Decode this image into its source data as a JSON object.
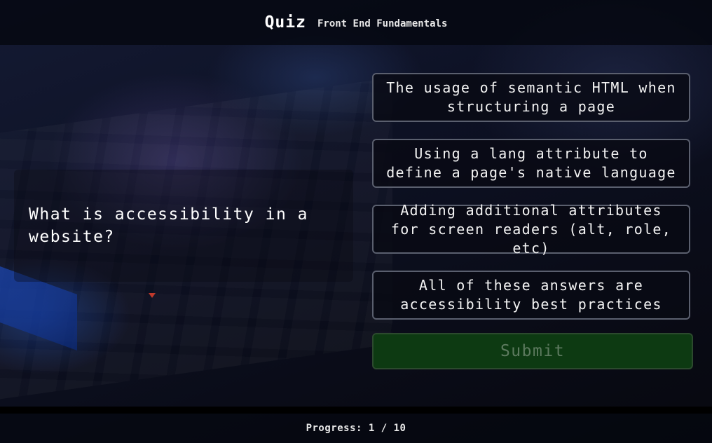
{
  "header": {
    "title": "Quiz",
    "subtitle": "Front End Fundamentals"
  },
  "question": {
    "text": "What is accessibility in a website?"
  },
  "answers": [
    {
      "label": "The usage of semantic HTML when structuring a page"
    },
    {
      "label": "Using a lang attribute to define a page's native language"
    },
    {
      "label": "Adding additional attributes for screen readers (alt, role, etc)"
    },
    {
      "label": "All of these answers are accessibility best practices"
    }
  ],
  "submit": {
    "label": "Submit",
    "state": "disabled"
  },
  "progress": {
    "label": "Progress: 1 / 10",
    "current": 1,
    "total": 10
  },
  "colors": {
    "submit_bg": "#0d3a12",
    "answer_border": "#5a5f6e"
  }
}
